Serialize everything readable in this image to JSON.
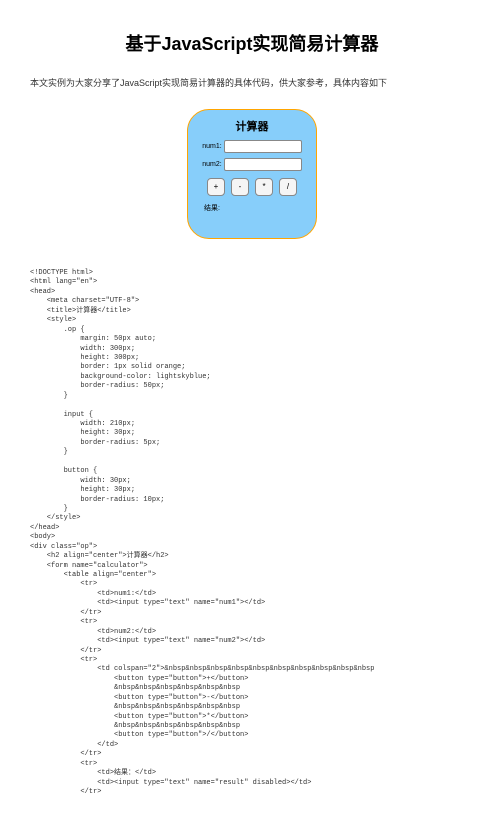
{
  "title": "基于JavaScript实现简易计算器",
  "intro": "本文实例为大家分享了JavaScript实现简易计算器的具体代码，供大家参考，具体内容如下",
  "preview": {
    "heading": "计算器",
    "label_num1": "num1:",
    "label_num2": "num2:",
    "btn_add": "+",
    "btn_sub": "-",
    "btn_mul": "*",
    "btn_div": "/",
    "label_result": "结果:"
  },
  "watermark": "",
  "code": "<!DOCTYPE html>\n<html lang=\"en\">\n<head>\n    <meta charset=\"UTF-8\">\n    <title>计算器</title>\n    <style>\n        .op {\n            margin: 50px auto;\n            width: 300px;\n            height: 300px;\n            border: 1px solid orange;\n            background-color: lightskyblue;\n            border-radius: 50px;\n        }\n\n        input {\n            width: 210px;\n            height: 30px;\n            border-radius: 5px;\n        }\n\n        button {\n            width: 30px;\n            height: 30px;\n            border-radius: 10px;\n        }\n    </style>\n</head>\n<body>\n<div class=\"op\">\n    <h2 align=\"center\">计算器</h2>\n    <form name=\"calculator\">\n        <table align=\"center\">\n            <tr>\n                <td>num1:</td>\n                <td><input type=\"text\" name=\"num1\"></td>\n            </tr>\n            <tr>\n                <td>num2:</td>\n                <td><input type=\"text\" name=\"num2\"></td>\n            </tr>\n            <tr>\n                <td colspan=\"2\">&nbsp&nbsp&nbsp&nbsp&nbsp&nbsp&nbsp&nbsp&nbsp&nbsp\n                    <button type=\"button\">+</button>\n                    &nbsp&nbsp&nbsp&nbsp&nbsp&nbsp\n                    <button type=\"button\">-</button>\n                    &nbsp&nbsp&nbsp&nbsp&nbsp&nbsp\n                    <button type=\"button\">*</button>\n                    &nbsp&nbsp&nbsp&nbsp&nbsp&nbsp\n                    <button type=\"button\">/</button>\n                </td>\n            </tr>\n            <tr>\n                <td>结果：</td>\n                <td><input type=\"text\" name=\"result\" disabled></td>\n            </tr>"
}
